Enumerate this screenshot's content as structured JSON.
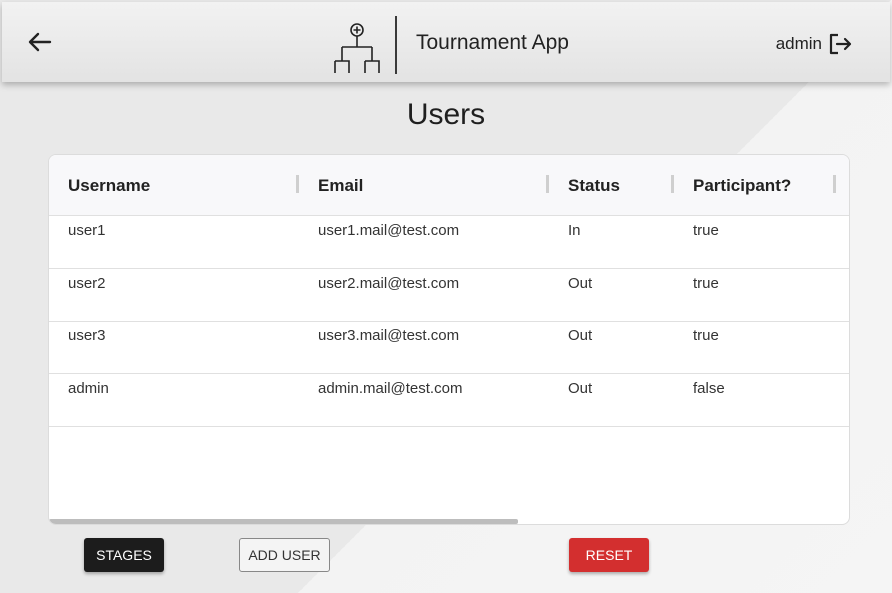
{
  "header": {
    "app_title": "Tournament App",
    "username": "admin",
    "icons": {
      "back": "arrow-left-icon",
      "logo": "tournament-bracket-icon",
      "logout": "logout-icon"
    }
  },
  "page": {
    "title": "Users"
  },
  "table": {
    "columns": [
      "Username",
      "Email",
      "Status",
      "Participant?"
    ],
    "rows": [
      {
        "username": "user1",
        "email": "user1.mail@test.com",
        "status": "In",
        "participant": "true"
      },
      {
        "username": "user2",
        "email": "user2.mail@test.com",
        "status": "Out",
        "participant": "true"
      },
      {
        "username": "user3",
        "email": "user3.mail@test.com",
        "status": "Out",
        "participant": "true"
      },
      {
        "username": "admin",
        "email": "admin.mail@test.com",
        "status": "Out",
        "participant": "false"
      }
    ]
  },
  "actions": {
    "stages_label": "STAGES",
    "add_user_label": "ADD USER",
    "reset_label": "RESET"
  },
  "colors": {
    "primary_button": "#1c1c1c",
    "reset_button": "#d32f2f",
    "header_background": "#ececec"
  }
}
